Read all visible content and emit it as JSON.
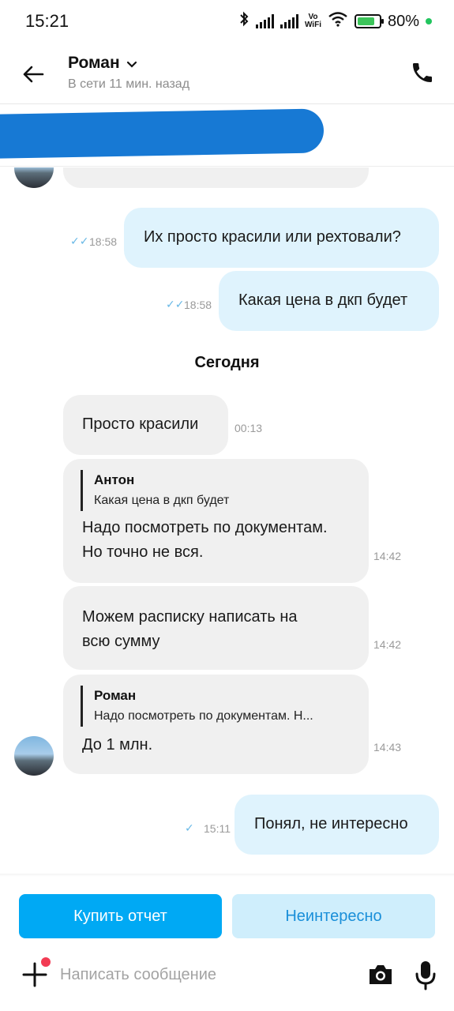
{
  "status_bar": {
    "time": "15:21",
    "battery_percent": "80%",
    "battery_level": 0.8,
    "vowifi_top": "Vo",
    "vowifi_bottom": "WiFi",
    "icons": [
      "bluetooth-icon",
      "signal-icon",
      "signal-icon",
      "vowifi-icon",
      "wifi-icon",
      "battery-charging-icon"
    ]
  },
  "header": {
    "contact_name": "Роман",
    "status": "В сети 11 мин. назад",
    "icons": [
      "back-arrow-icon",
      "chevron-down-icon",
      "phone-icon"
    ]
  },
  "chat": {
    "messages": [
      {
        "direction": "out",
        "text": "Их просто красили или рехтовали?",
        "time": "18:58",
        "read": true
      },
      {
        "direction": "out",
        "text": "Какая цена в дкп будет",
        "time": "18:58",
        "read": true
      },
      {
        "direction": "in",
        "text": "Просто красили",
        "time": "00:13"
      },
      {
        "direction": "in",
        "quote_author": "Антон",
        "quote_text": "Какая цена в дкп будет",
        "text_lines": [
          "Надо посмотреть по документам.",
          "Но точно не вся."
        ],
        "time": "14:42"
      },
      {
        "direction": "in",
        "text_lines": [
          "Можем расписку написать на",
          "всю сумму"
        ],
        "time": "14:42"
      },
      {
        "direction": "in",
        "quote_author": "Роман",
        "quote_text": "Надо посмотреть по документам. Н...",
        "text": "До 1 млн.",
        "time": "14:43"
      },
      {
        "direction": "out",
        "text": "Понял, не интересно",
        "time": "15:11",
        "read": false
      }
    ],
    "day_separator": "Сегодня"
  },
  "actions": {
    "buy_report": "Купить отчет",
    "not_interested": "Неинтересно"
  },
  "composer": {
    "placeholder": "Написать сообщение",
    "icons": [
      "plus-icon",
      "camera-icon",
      "microphone-icon"
    ]
  },
  "colors": {
    "accent": "#00a9f4",
    "outgoing_bubble": "#dff3fd",
    "incoming_bubble": "#f0f0f0",
    "secondary_button": "#cfeefc",
    "secondary_button_text": "#1a8fd9",
    "notification_dot": "#f23b53",
    "online_dot": "#22c55e"
  }
}
